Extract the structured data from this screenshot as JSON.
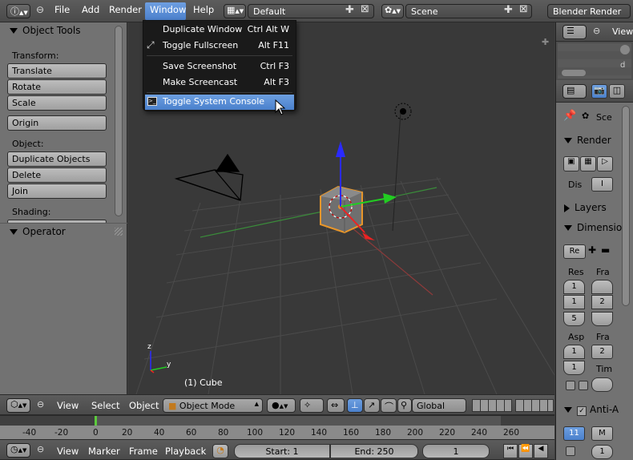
{
  "top_menu": {
    "items": [
      "File",
      "Add",
      "Render",
      "Window",
      "Help"
    ],
    "active": "Window"
  },
  "screen_layout": "Default",
  "scene_name": "Scene",
  "render_engine": "Blender Render",
  "window_menu": {
    "items": [
      {
        "label": "Duplicate Window",
        "shortcut": "Ctrl Alt W"
      },
      {
        "label": "Toggle Fullscreen",
        "shortcut": "Alt F11"
      },
      {
        "label": "Save Screenshot",
        "shortcut": "Ctrl F3"
      },
      {
        "label": "Make Screencast",
        "shortcut": "Alt F3"
      },
      {
        "label": "Toggle System Console",
        "shortcut": ""
      }
    ]
  },
  "tool_shelf": {
    "title": "Object Tools",
    "transform_label": "Transform:",
    "translate": "Translate",
    "rotate": "Rotate",
    "scale": "Scale",
    "origin": "Origin",
    "object_label": "Object:",
    "duplicate": "Duplicate Objects",
    "delete": "Delete",
    "join": "Join",
    "shading_label": "Shading:",
    "operator": "Operator"
  },
  "viewport": {
    "object_label": "(1) Cube",
    "axis_y": "y",
    "axis_z": "z"
  },
  "view3d_header": {
    "view": "View",
    "select": "Select",
    "object": "Object",
    "mode": "Object Mode",
    "orientation": "Global"
  },
  "outliner": {
    "view": "View",
    "partial_text": "d"
  },
  "properties": {
    "scene": "Sce",
    "render": "Render",
    "display": "Dis",
    "display_val": "I",
    "layers": "Layers",
    "dimensions": "Dimensio",
    "preset": "Re",
    "res_label": "Res",
    "fra_label": "Fra",
    "res_vals": [
      "1",
      "1",
      "5"
    ],
    "fra_vals": [
      "",
      "2",
      ""
    ],
    "asp_label": "Asp",
    "fra2_label": "Fra",
    "fra2_val": "2",
    "asp_vals": [
      "1",
      "1"
    ],
    "tim_label": "Tim",
    "anti_alias": "Anti-A",
    "aa_val": "11",
    "aa_m": "M",
    "aa_bottom": "1"
  },
  "timeline": {
    "ticks": [
      "-40",
      "-20",
      "0",
      "20",
      "40",
      "60",
      "80",
      "100",
      "120",
      "140",
      "160",
      "180",
      "200",
      "220",
      "240",
      "260"
    ],
    "view": "View",
    "marker": "Marker",
    "frame": "Frame",
    "playback": "Playback",
    "start": "Start: 1",
    "end": "End: 250",
    "current": "1"
  }
}
